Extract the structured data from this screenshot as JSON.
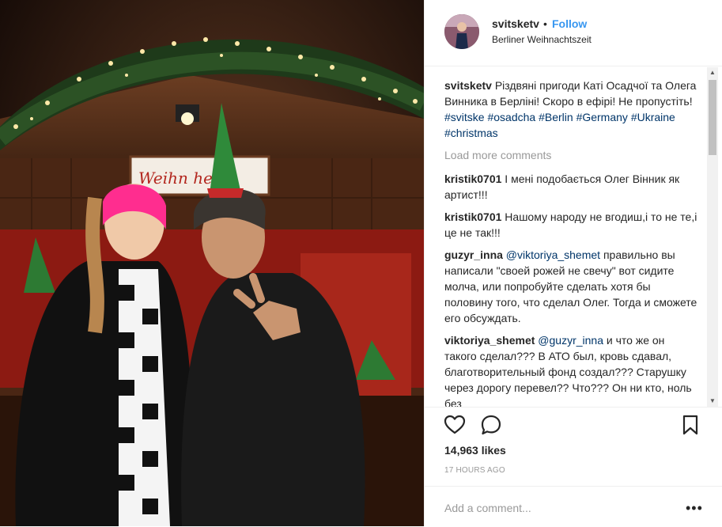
{
  "post": {
    "username": "svitsketv",
    "separator": "•",
    "follow_label": "Follow",
    "location": "Berliner Weihnachtszeit",
    "booth_sign": "Weihn      hen",
    "caption_text": "Різдвяні пригоди Каті Осадчої та Олега Винника в Берліні! Скоро в ефірі! Не пропустіть!",
    "hashtags": [
      "#svitske",
      "#osadcha",
      "#Berlin",
      "#Germany",
      "#Ukraine",
      "#christmas"
    ],
    "load_more": "Load more comments",
    "likes": "14,963 likes",
    "time": "17 HOURS AGO",
    "add_comment_placeholder": "Add a comment...",
    "more_label": "•••"
  },
  "comments": [
    {
      "user": "kristik0701",
      "text": "І мені подобається Олег Вінник як артист!!!"
    },
    {
      "user": "kristik0701",
      "text": "Нашому народу не вгодиш,і то не те,і це не так!!!"
    },
    {
      "user": "guzyr_inna",
      "mention": "@viktoriya_shemet",
      "text": "правильно вы написали \"своей рожей не свечу\" вот сидите молча, или попробуйте сделать хотя бы половину того, что сделал Олег. Тогда и сможете его обсуждать."
    },
    {
      "user": "viktoriya_shemet",
      "mention": "@guzyr_inna",
      "text": "и что же он такого сделал??? В АТО был, кровь сдавал, благотворительный фонд создал??? Старушку через дорогу перевел?? Что??? Он ни кто, ноль без"
    }
  ],
  "icons": {
    "like": "heart-icon",
    "comment": "comment-bubble-icon",
    "save": "bookmark-icon",
    "more": "more-options-icon"
  },
  "colors": {
    "link_blue": "#3897f0",
    "hashtag": "#003569",
    "muted": "#999999",
    "text": "#262626"
  }
}
